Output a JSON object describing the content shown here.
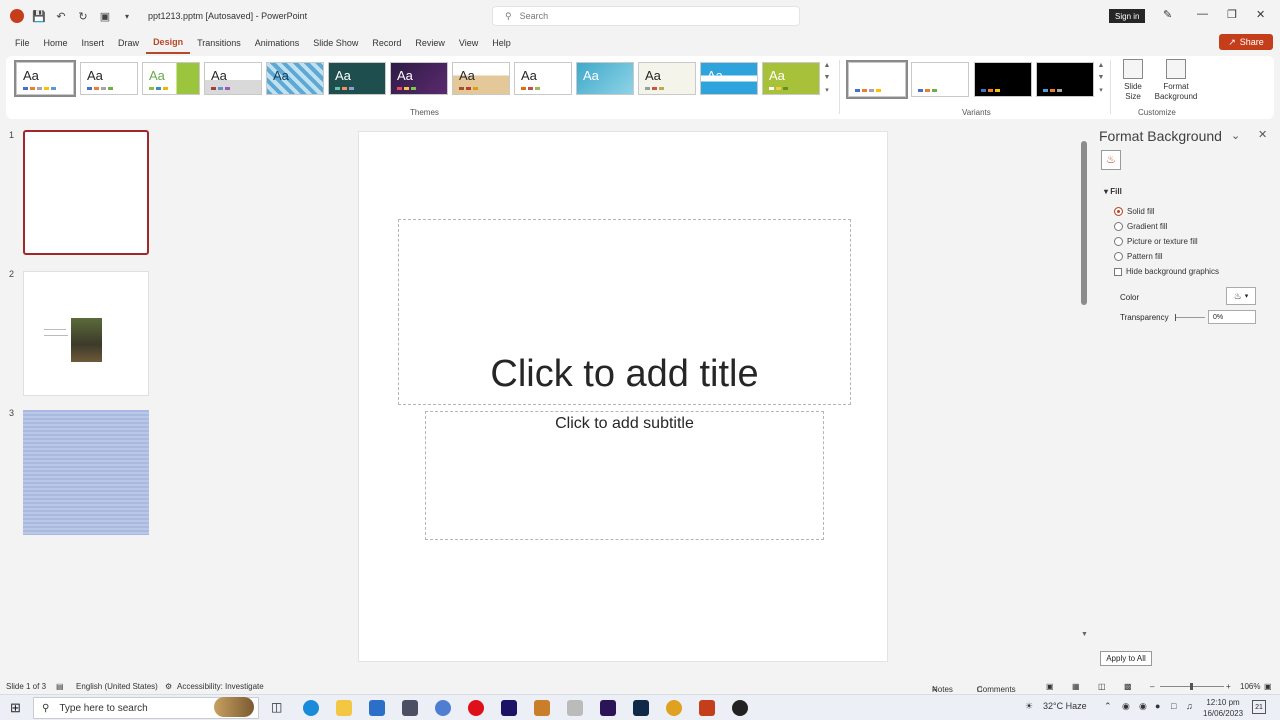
{
  "titlebar": {
    "file_name": "ppt1213.pptm [Autosaved]",
    "separator": "-",
    "app_name": "PowerPoint",
    "search_placeholder": "Search",
    "sign_in": "Sign in"
  },
  "tabs": [
    "File",
    "Home",
    "Insert",
    "Draw",
    "Design",
    "Transitions",
    "Animations",
    "Slide Show",
    "Record",
    "Review",
    "View",
    "Help"
  ],
  "active_tab": "Design",
  "share_label": "Share",
  "ribbon": {
    "themes_label": "Themes",
    "variants_label": "Variants",
    "customize_label": "Customize",
    "theme_text": "Aa",
    "slide_size": "Slide Size",
    "format_background": "Format Background"
  },
  "slide_numbers": [
    "1",
    "2",
    "3"
  ],
  "slide": {
    "title_placeholder": "Click to add title",
    "subtitle_placeholder": "Click to add subtitle"
  },
  "pane": {
    "title": "Format Background",
    "section": "Fill",
    "options": [
      "Solid fill",
      "Gradient fill",
      "Picture or texture fill",
      "Pattern fill"
    ],
    "selected_option": "Solid fill",
    "hide_graphics": "Hide background graphics",
    "color_label": "Color",
    "transparency_label": "Transparency",
    "transparency_value": "0%",
    "apply_all": "Apply to All"
  },
  "statusbar": {
    "slide_info": "Slide 1 of 3",
    "language": "English (United States)",
    "accessibility": "Accessibility: Investigate",
    "notes": "Notes",
    "comments": "Comments",
    "zoom": "106%"
  },
  "taskbar": {
    "search_placeholder": "Type here to search",
    "temperature": "32°C",
    "weather": "Haze",
    "time": "12:10 pm",
    "date": "16/06/2023",
    "notification_count": "21"
  },
  "colors": {
    "accent": "#b7472a",
    "brand": "#c43e1c"
  }
}
